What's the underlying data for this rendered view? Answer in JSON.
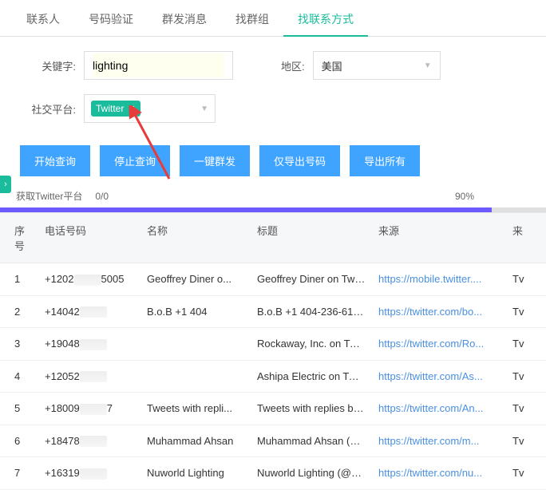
{
  "tabs": {
    "contacts": "联系人",
    "verify": "号码验证",
    "groupmsg": "群发消息",
    "findgroup": "找群组",
    "findcontact": "找联系方式"
  },
  "filters": {
    "keyword_label": "关键字:",
    "keyword_value": "lighting",
    "region_label": "地区:",
    "region_value": "美国",
    "platform_label": "社交平台:",
    "platform_tag": "Twitter"
  },
  "buttons": {
    "start": "开始查询",
    "stop": "停止查询",
    "groupsend": "一键群发",
    "exportnum": "仅导出号码",
    "exportall": "导出所有"
  },
  "status": {
    "fetching": "获取Twitter平台",
    "count": "0/0",
    "percent": "90%"
  },
  "columns": {
    "idx": "序号",
    "phone": "电话号码",
    "name": "名称",
    "title": "标题",
    "source": "来源",
    "src2": "来"
  },
  "rows": [
    {
      "idx": "1",
      "phone_pre": "+1202",
      "phone_suf": "5005",
      "name": "Geoffrey Diner o...",
      "title": "Geoffrey Diner on Twit...",
      "source": "https://mobile.twitter....",
      "src2": "Tv"
    },
    {
      "idx": "2",
      "phone_pre": "+14042",
      "phone_suf": "",
      "name": "B.o.B +1 404",
      "title": "B.o.B +1 404-236-612...",
      "source": "https://twitter.com/bo...",
      "src2": "Tv"
    },
    {
      "idx": "3",
      "phone_pre": "+19048",
      "phone_suf": "",
      "name": "",
      "title": "Rockaway, Inc. on Twit...",
      "source": "https://twitter.com/Ro...",
      "src2": "Tv"
    },
    {
      "idx": "4",
      "phone_pre": "+12052",
      "phone_suf": "",
      "name": "",
      "title": "Ashipa Electric on Twit...",
      "source": "https://twitter.com/As...",
      "src2": "Tv"
    },
    {
      "idx": "5",
      "phone_pre": "+18009",
      "phone_suf": "7",
      "name": "Tweets with repli...",
      "title": "Tweets with replies by...",
      "source": "https://twitter.com/An...",
      "src2": "Tv"
    },
    {
      "idx": "6",
      "phone_pre": "+18478",
      "phone_suf": "",
      "name": "Muhammad Ahsan",
      "title": "Muhammad Ahsan (@...",
      "source": "https://twitter.com/m...",
      "src2": "Tv"
    },
    {
      "idx": "7",
      "phone_pre": "+16319",
      "phone_suf": "",
      "name": "Nuworld Lighting",
      "title": "Nuworld Lighting (@n...",
      "source": "https://twitter.com/nu...",
      "src2": "Tv"
    }
  ]
}
